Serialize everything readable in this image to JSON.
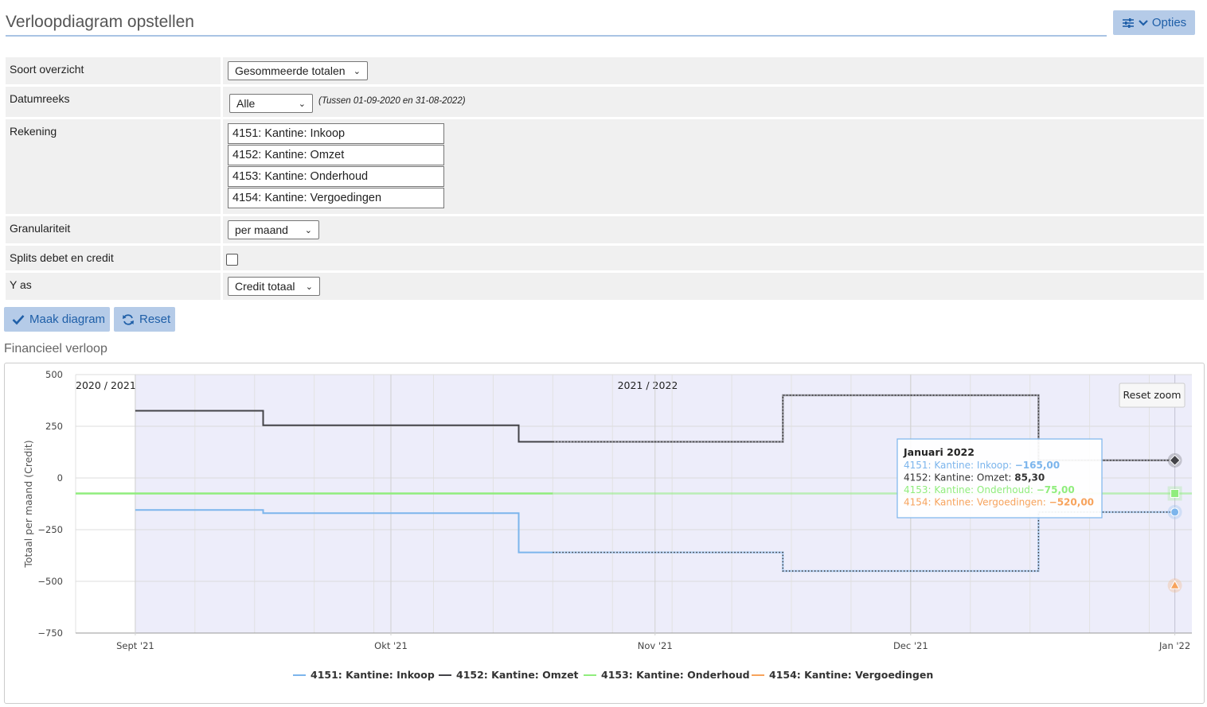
{
  "page": {
    "title": "Verloopdiagram opstellen",
    "options_label": "Opties"
  },
  "form": {
    "soort_label": "Soort overzicht",
    "soort_value": "Gesommeerde totalen",
    "datumreeks_label": "Datumreeks",
    "datumreeks_value": "Alle",
    "datumreeks_hint": "(Tussen 01-09-2020 en 31-08-2022)",
    "rekening_label": "Rekening",
    "rekeningen": [
      "4151: Kantine: Inkoop",
      "4152: Kantine: Omzet",
      "4153: Kantine: Onderhoud",
      "4154: Kantine: Vergoedingen"
    ],
    "granulariteit_label": "Granulariteit",
    "granulariteit_value": "per maand",
    "splits_label": "Splits debet en credit",
    "splits_checked": false,
    "yas_label": "Y as",
    "yas_value": "Credit totaal"
  },
  "buttons": {
    "maak_label": "Maak diagram",
    "reset_label": "Reset"
  },
  "chart_section": {
    "title": "Financieel verloop",
    "reset_zoom_label": "Reset zoom",
    "tooltip_title": "Januari 2022",
    "tooltip_lines": [
      {
        "name": "4151: Kantine: Inkoop",
        "value": "−165,00"
      },
      {
        "name": "4152: Kantine: Omzet",
        "value": "85,30"
      },
      {
        "name": "4153: Kantine: Onderhoud",
        "value": "−75,00"
      },
      {
        "name": "4154: Kantine: Vergoedingen",
        "value": "−520,00"
      }
    ]
  },
  "chart_data": {
    "type": "line",
    "ylabel": "Totaal per maand (Credit)",
    "ylim": [
      -750,
      500
    ],
    "yticks": [
      500,
      250,
      0,
      -250,
      -500,
      -750
    ],
    "xticks": [
      "Sept '21",
      "Okt '21",
      "Nov '21",
      "Dec '21",
      "Jan '22"
    ],
    "xrange": [
      "2021-08-25",
      "2022-01-03"
    ],
    "plot_bands": [
      {
        "label": "2020 / 2021",
        "from": "2021-08-25",
        "to": "2021-08-31"
      },
      {
        "label": "2021 / 2022",
        "from": "2021-09-01",
        "to": "2022-01-03"
      }
    ],
    "grid": true,
    "legend_position": "bottom",
    "series": [
      {
        "name": "4151: Kantine: Inkoop",
        "color": "#7cb5ec",
        "points": [
          [
            "2021-09-01",
            -155
          ],
          [
            "2021-09-16",
            -170
          ],
          [
            "2021-10-16",
            -360
          ],
          [
            "2021-11-16",
            -450
          ],
          [
            "2021-12-16",
            -165
          ],
          [
            "2022-01-01",
            -165
          ]
        ]
      },
      {
        "name": "4152: Kantine: Omzet",
        "color": "#434348",
        "points": [
          [
            "2021-09-01",
            325
          ],
          [
            "2021-09-16",
            255
          ],
          [
            "2021-10-16",
            175
          ],
          [
            "2021-11-16",
            400
          ],
          [
            "2021-12-16",
            85.3
          ],
          [
            "2022-01-01",
            85.3
          ]
        ]
      },
      {
        "name": "4153: Kantine: Onderhoud",
        "color": "#90ed7d",
        "points": [
          [
            "2021-08-25",
            -75
          ],
          [
            "2022-01-03",
            -75
          ]
        ]
      },
      {
        "name": "4154: Kantine: Vergoedingen",
        "color": "#f7a35c",
        "points": [
          [
            "2022-01-01",
            -520
          ]
        ]
      }
    ]
  }
}
